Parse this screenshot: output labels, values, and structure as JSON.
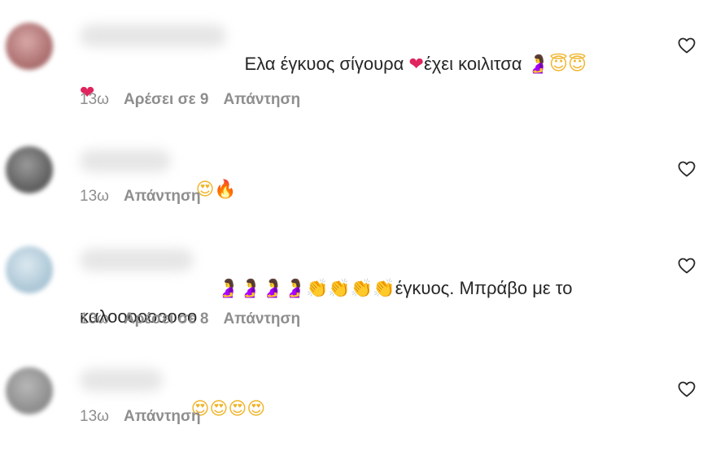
{
  "comments": [
    {
      "text_before": "Ελα έγκυος σίγουρα ",
      "emoji_1": "❤",
      "text_middle": "έχει κοιλιτσα ",
      "emoji_2": "🤰",
      "emoji_3": "😇",
      "emoji_4": "😇",
      "emoji_5": "❤",
      "time": "13ω",
      "likes": "Αρέσει σε 9",
      "reply": "Απάντηση"
    },
    {
      "emoji_1": "😍",
      "emoji_2": "🔥",
      "time": "13ω",
      "reply": "Απάντηση"
    },
    {
      "emojis_pregnant": "🤰🤰🤰🤰",
      "emojis_clap": "👏👏👏👏",
      "text_after": "έγκυος. Μπράβο με το",
      "text_line2": "καλοοοοοοοοο",
      "time": "13ω",
      "likes": "Αρέσει σε 8",
      "reply": "Απάντηση"
    },
    {
      "emojis": "😍😍😍😍",
      "time": "13ω",
      "reply": "Απάντηση"
    }
  ],
  "icons": {
    "like": "heart-outline-icon"
  },
  "colors": {
    "text": "#262626",
    "meta": "#8e8e8e",
    "heart_emoji": "#e0245e"
  }
}
